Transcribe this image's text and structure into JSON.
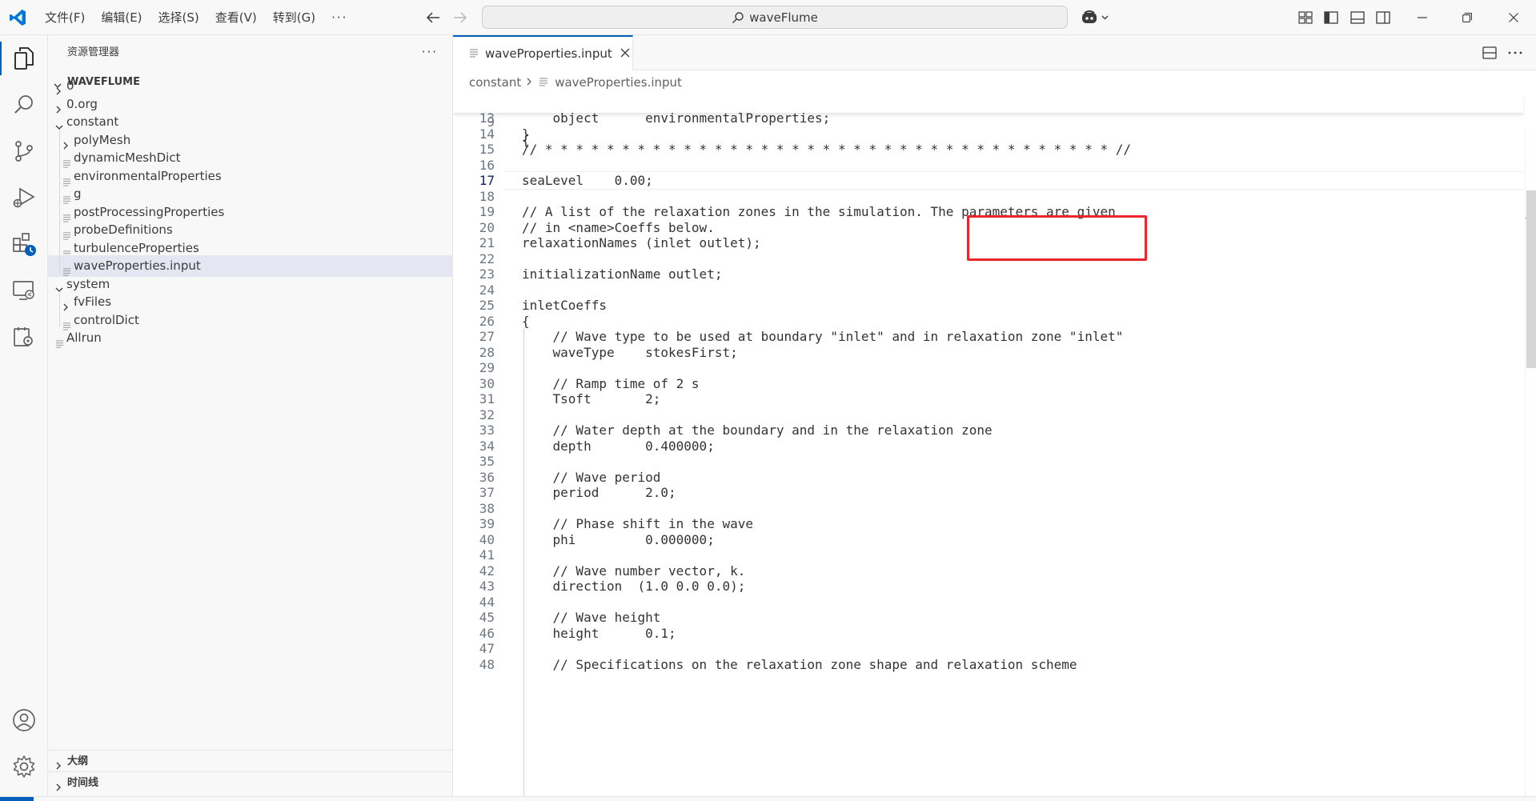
{
  "titlebar": {
    "menu": [
      "文件(F)",
      "编辑(E)",
      "选择(S)",
      "查看(V)",
      "转到(G)"
    ],
    "more": "···",
    "search": "waveFlume"
  },
  "sidebar": {
    "header": "资源管理器",
    "more": "···",
    "workspace": "WAVEFLUME",
    "tree": [
      {
        "label": "0",
        "kind": "folder",
        "expanded": false,
        "depth": 0
      },
      {
        "label": "0.org",
        "kind": "folder",
        "expanded": false,
        "depth": 0
      },
      {
        "label": "constant",
        "kind": "folder",
        "expanded": true,
        "depth": 0
      },
      {
        "label": "polyMesh",
        "kind": "folder",
        "expanded": false,
        "depth": 1
      },
      {
        "label": "dynamicMeshDict",
        "kind": "file",
        "depth": 1
      },
      {
        "label": "environmentalProperties",
        "kind": "file",
        "depth": 1
      },
      {
        "label": "g",
        "kind": "file",
        "depth": 1
      },
      {
        "label": "postProcessingProperties",
        "kind": "file",
        "depth": 1
      },
      {
        "label": "probeDefinitions",
        "kind": "file",
        "depth": 1
      },
      {
        "label": "turbulenceProperties",
        "kind": "file",
        "depth": 1
      },
      {
        "label": "waveProperties.input",
        "kind": "file",
        "depth": 1,
        "selected": true
      },
      {
        "label": "system",
        "kind": "folder",
        "expanded": true,
        "depth": 0
      },
      {
        "label": "fvFiles",
        "kind": "folder",
        "expanded": false,
        "depth": 1
      },
      {
        "label": "controlDict",
        "kind": "file",
        "depth": 1
      },
      {
        "label": "Allrun",
        "kind": "file",
        "depth": 0
      }
    ],
    "sections": [
      "大纲",
      "时间线"
    ]
  },
  "editor": {
    "tab": "waveProperties.input",
    "breadcrumb": [
      "constant",
      "waveProperties.input"
    ],
    "sticky": {
      "num": "9",
      "text": "{"
    },
    "active_line": "17",
    "lines": [
      {
        "num": "13",
        "text": "    object      environmentalProperties;"
      },
      {
        "num": "14",
        "text": "}"
      },
      {
        "num": "15",
        "text": "// * * * * * * * * * * * * * * * * * * * * * * * * * * * * * * * * * * * * * //"
      },
      {
        "num": "16",
        "text": ""
      },
      {
        "num": "17",
        "text": "seaLevel    0.00;"
      },
      {
        "num": "18",
        "text": ""
      },
      {
        "num": "19",
        "text": "// A list of the relaxation zones in the simulation. The parameters are given"
      },
      {
        "num": "20",
        "text": "// in <name>Coeffs below."
      },
      {
        "num": "21",
        "text": "relaxationNames (inlet outlet);"
      },
      {
        "num": "22",
        "text": ""
      },
      {
        "num": "23",
        "text": "initializationName outlet;"
      },
      {
        "num": "24",
        "text": ""
      },
      {
        "num": "25",
        "text": "inletCoeffs"
      },
      {
        "num": "26",
        "text": "{"
      },
      {
        "num": "27",
        "text": "    // Wave type to be used at boundary \"inlet\" and in relaxation zone \"inlet\""
      },
      {
        "num": "28",
        "text": "    waveType    stokesFirst;"
      },
      {
        "num": "29",
        "text": ""
      },
      {
        "num": "30",
        "text": "    // Ramp time of 2 s"
      },
      {
        "num": "31",
        "text": "    Tsoft       2;"
      },
      {
        "num": "32",
        "text": ""
      },
      {
        "num": "33",
        "text": "    // Water depth at the boundary and in the relaxation zone"
      },
      {
        "num": "34",
        "text": "    depth       0.400000;"
      },
      {
        "num": "35",
        "text": ""
      },
      {
        "num": "36",
        "text": "    // Wave period"
      },
      {
        "num": "37",
        "text": "    period      2.0;"
      },
      {
        "num": "38",
        "text": ""
      },
      {
        "num": "39",
        "text": "    // Phase shift in the wave"
      },
      {
        "num": "40",
        "text": "    phi         0.000000;"
      },
      {
        "num": "41",
        "text": ""
      },
      {
        "num": "42",
        "text": "    // Wave number vector, k."
      },
      {
        "num": "43",
        "text": "    direction  (1.0 0.0 0.0);"
      },
      {
        "num": "44",
        "text": ""
      },
      {
        "num": "45",
        "text": "    // Wave height"
      },
      {
        "num": "46",
        "text": "    height      0.1;"
      },
      {
        "num": "47",
        "text": ""
      },
      {
        "num": "48",
        "text": "    // Specifications on the relaxation zone shape and relaxation scheme"
      }
    ]
  },
  "colors": {
    "accent": "#005fb8",
    "highlight": "#e8262b",
    "selection": "#e4e6f1"
  }
}
